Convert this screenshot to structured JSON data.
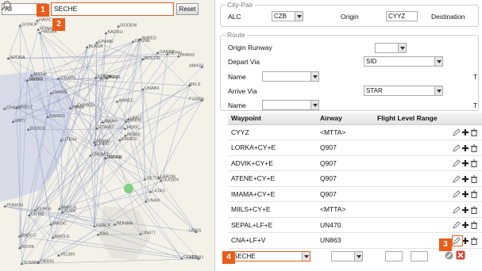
{
  "map": {
    "filter_value": "All",
    "search_value": "SECHE",
    "reset_label": "Reset",
    "labels": [
      "LORKA",
      "ODIBA",
      "UNR0",
      "RADLO",
      "LANDE",
      "TUSR",
      "ANBED",
      "PUSIL",
      "ROLOD",
      "EAMES",
      "HADAN",
      "ADIMO",
      "BUDOX",
      "AMIGO",
      "ENOMO",
      "UNAB4",
      "OBRIS",
      "CORNI",
      "ARREC",
      "KEPER",
      "DOMOD",
      "ADVIK",
      "AMOLE",
      "SOMED",
      "UNS7",
      "GUGEN",
      "ATENE",
      "EPAME",
      "UNTI",
      "GETLU",
      "FUDRA",
      "ARMAL",
      "EDALA",
      "ETAMO",
      "OYGEN",
      "GANGE",
      "AMBUS",
      "CELTO",
      "UNSS",
      "LARON",
      "GODEM",
      "FEMA",
      "DARBO",
      "UNAB",
      "VELBN",
      "CHALA",
      "PERIC",
      "SOMAK",
      "KAS",
      "REMIE",
      "UNTIS",
      "MIILS",
      "ARDNA",
      "LATAS",
      "UN477",
      "MAGIC",
      "RONAM",
      "GONUP",
      "NOHAM",
      "UNR63",
      "BADRU",
      "UTE44",
      "UNBS7",
      "CHAVE",
      "SEPAL",
      "HAVIC",
      "OPUNE",
      "BLASA",
      "IBRAP",
      "POMON",
      "PERDU",
      "MAGCI"
    ]
  },
  "callouts": [
    "1",
    "2",
    "3",
    "4"
  ],
  "city_pair": {
    "legend": "City-Pair",
    "alc_label": "ALC",
    "alc_value": "CZB",
    "origin_label": "Origin",
    "origin_value": "CYYZ",
    "destination_label": "Destination"
  },
  "route": {
    "legend": "Route",
    "origin_runway_label": "Origin Runway",
    "origin_runway_value": "",
    "depart_via_label": "Depart Via",
    "depart_via_value": "SID",
    "name_label": "Name",
    "arrive_via_label": "Arrive Via",
    "arrive_via_value": "STAR",
    "name2_label": "Name",
    "trailing_t": "T",
    "trailing_t2": "T"
  },
  "table": {
    "headers": [
      "Waypoint",
      "Airway",
      "Flight Level Range"
    ],
    "rows": [
      {
        "waypoint": "CYYZ",
        "airway": "<MTTA>"
      },
      {
        "waypoint": "LORKA+CY+E",
        "airway": "Q907"
      },
      {
        "waypoint": "ADVIK+CY+E",
        "airway": "Q907"
      },
      {
        "waypoint": "ATENE+CY+E",
        "airway": "Q907"
      },
      {
        "waypoint": "IMAMA+CY+E",
        "airway": "Q907"
      },
      {
        "waypoint": "MIILS+CY+E",
        "airway": "<MTTA>"
      },
      {
        "waypoint": "SEPAL+LF+E",
        "airway": "UN470"
      },
      {
        "waypoint": "CNA+LF+V",
        "airway": "UN863"
      }
    ],
    "new_waypoint_value": "SECHE",
    "new_airway_value": ""
  },
  "colors": {
    "accent": "#e85d1a",
    "map_bg": "#f3f1e8",
    "water": "#d7dbe8",
    "route_line": "#9fa8c8",
    "add_icon": "#222222",
    "delete_icon": "#cc3333",
    "marker": "#7fd17f"
  }
}
